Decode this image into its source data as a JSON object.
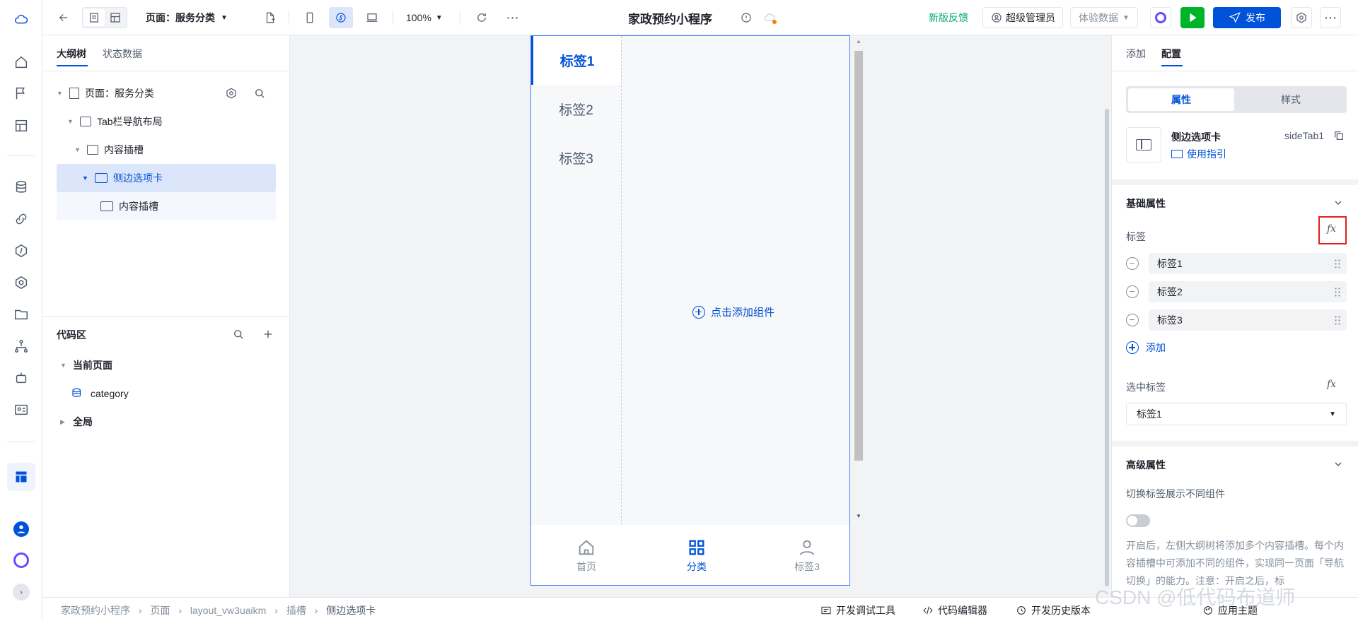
{
  "topbar": {
    "page_selector": "页面：服务分类",
    "zoom": "100%",
    "app_title": "家政预约小程序",
    "feedback": "新版反馈",
    "user": "超级管理员",
    "data_env": "体验数据",
    "publish": "发布"
  },
  "left_panel": {
    "tabs": [
      "大纲树",
      "状态数据"
    ],
    "tree": [
      {
        "label": "页面：服务分类"
      },
      {
        "label": "Tab栏导航布局"
      },
      {
        "label": "内容插槽"
      },
      {
        "label": "侧边选项卡"
      },
      {
        "label": "内容插槽"
      }
    ],
    "code_area": {
      "title": "代码区",
      "current_page": "当前页面",
      "item": "category",
      "global": "全局"
    }
  },
  "canvas": {
    "side_tabs": [
      "标签1",
      "标签2",
      "标签3"
    ],
    "add_component": "点击添加组件",
    "bottom_nav": [
      "首页",
      "分类",
      "标签3"
    ]
  },
  "right_panel": {
    "tabs": [
      "添加",
      "配置"
    ],
    "seg": [
      "属性",
      "样式"
    ],
    "component_name": "侧边选项卡",
    "component_id": "sideTab1",
    "guide": "使用指引",
    "basic_title": "基础属性",
    "tag_label": "标签",
    "tags": [
      "标签1",
      "标签2",
      "标签3"
    ],
    "add": "添加",
    "selected_label": "选中标签",
    "selected_value": "标签1",
    "advanced_title": "高级属性",
    "toggle_label": "切换标签展示不同组件",
    "desc": "开启后，左侧大纲树将添加多个内容插槽。每个内容插槽中可添加不同的组件，实现同一页面「导航切换」的能力。注意：开启之后，标"
  },
  "statusbar": {
    "breadcrumb": [
      "家政预约小程序",
      "页面",
      "layout_vw3uaikm",
      "插槽",
      "侧边选项卡"
    ],
    "dev_tools": "开发调试工具",
    "code_editor": "代码编辑器",
    "history": "开发历史版本",
    "theme": "应用主题"
  },
  "watermark": "CSDN @低代码布道师",
  "colors": {
    "accent": "#0052d9",
    "feedback": "#00a870",
    "run": "#00b42a",
    "highlight": "#e02020"
  }
}
